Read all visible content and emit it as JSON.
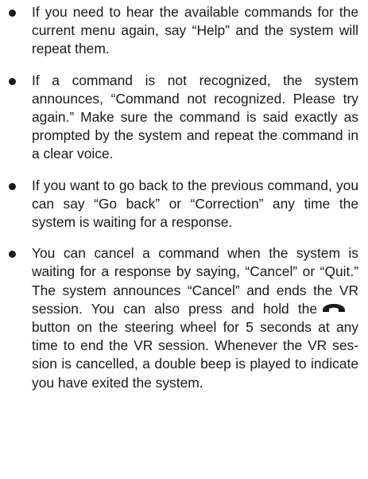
{
  "bullets": [
    {
      "text": "If you need to hear the available commands for the current menu again, say “Help” and the system will repeat them."
    },
    {
      "text": "If a command is not recognized, the system announces, “Command not recognized. Please try again.” Make sure the command is said exactly as prompted by the system and repeat the command in a clear voice."
    },
    {
      "text": "If you want to go back to the previous com­mand, you can say “Go back” or “Correc­tion” any time the system is waiting for a response."
    },
    {
      "text_before_icon": "You can cancel a command when the sys­tem is waiting for a response by saying, “Cancel” or “Quit.” The system announces “Cancel” and ends the VR session. You can also press and hold the",
      "icon": "phone-hang-up-icon",
      "text_after_icon": "button on the steering wheel for 5 seconds at any time to end the VR session. Whenever the VR ses­sion is cancelled, a double beep is played to indicate you have exited the system."
    }
  ]
}
